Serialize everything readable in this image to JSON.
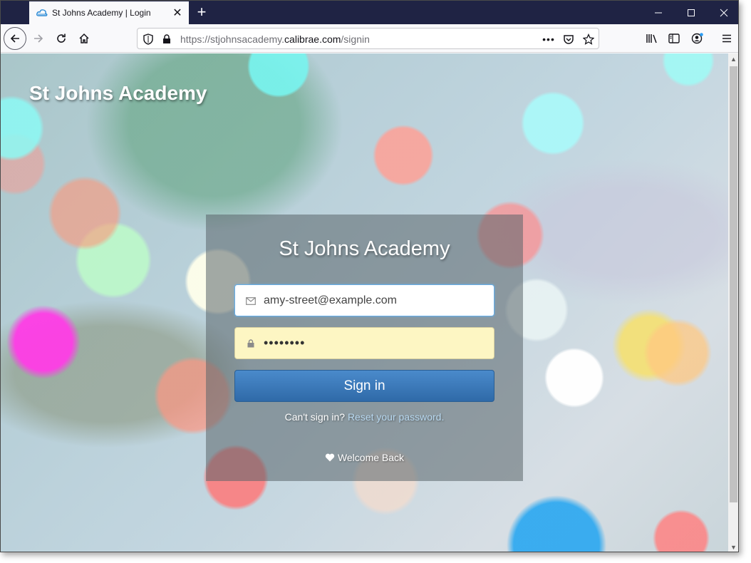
{
  "browser": {
    "tab": {
      "title": "St Johns Academy | Login"
    },
    "url": {
      "prefix": "https://stjohnsacademy.",
      "host": "calibrae.com",
      "path": "/signin"
    }
  },
  "page": {
    "site_title": "St Johns Academy",
    "login": {
      "title": "St Johns Academy",
      "email": {
        "value": "amy-street@example.com"
      },
      "password": {
        "value": "••••••••"
      },
      "signin_label": "Sign in",
      "cant_sign_in": "Can't sign in?",
      "reset_link": "Reset your password.",
      "welcome": "Welcome Back"
    }
  },
  "colors": {
    "tabbar": "#1f2344",
    "signin_button": "#3a78b8",
    "password_field": "#fdf6c3"
  },
  "icons": [
    "cloud-favicon-icon",
    "close-icon",
    "plus-icon",
    "minimize-icon",
    "maximize-icon",
    "window-close-icon",
    "back-arrow-icon",
    "forward-arrow-icon",
    "reload-icon",
    "home-icon",
    "shield-icon",
    "lock-icon",
    "more-icon",
    "pocket-icon",
    "star-icon",
    "library-icon",
    "sidebar-icon",
    "account-icon",
    "menu-icon",
    "envelope-icon",
    "padlock-icon",
    "heart-icon"
  ]
}
